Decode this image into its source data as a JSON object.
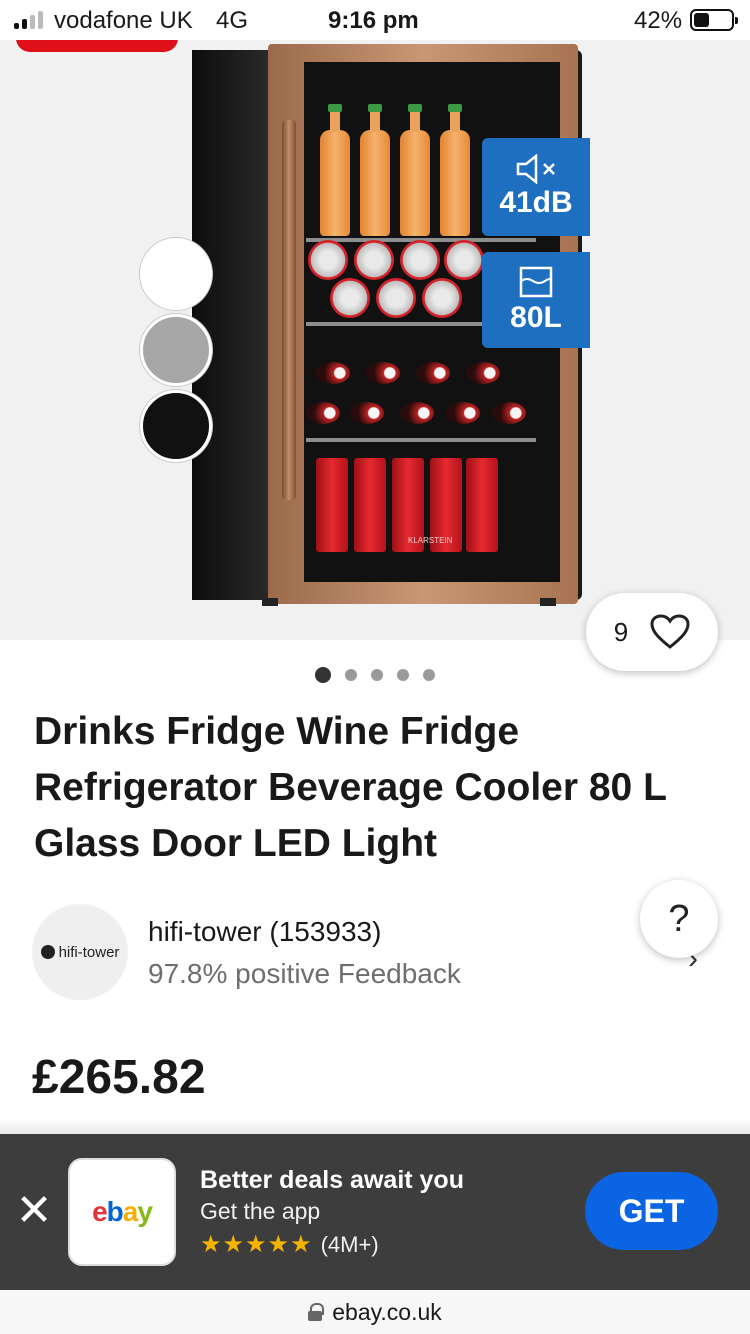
{
  "status_bar": {
    "carrier": "vodafone UK",
    "network": "4G",
    "time": "9:16 pm",
    "battery_percent": "42%",
    "battery_level": 0.42
  },
  "gallery": {
    "spec_badges": [
      {
        "value": "41dB",
        "icon": "speaker-mute-icon"
      },
      {
        "value": "80L",
        "icon": "capacity-icon"
      }
    ],
    "colour_swatches": [
      "#ffffff",
      "#a7a7a7",
      "#111111"
    ],
    "current_image": 1,
    "image_count": 5,
    "watch_count": "9",
    "product_brand_print": "KLARSTEIN"
  },
  "product": {
    "title": "Drinks Fridge Wine Fridge Refrigerator Beverage Cooler 80 L Glass Door LED Light",
    "price": "£265.82"
  },
  "seller": {
    "avatar_text": "hifi-tower",
    "name": "hifi-tower (153933)",
    "feedback": "97.8% positive Feedback"
  },
  "help": {
    "label": "?"
  },
  "app_banner": {
    "headline": "Better deals await you",
    "subline": "Get the app",
    "stars": "★★★★★",
    "rating_count": "(4M+)",
    "cta": "GET",
    "close": "✕",
    "logo": {
      "e": "e",
      "b": "b",
      "a": "a",
      "y": "y"
    }
  },
  "url_bar": {
    "domain": "ebay.co.uk"
  },
  "colors": {
    "accent_blue": "#0a64e4",
    "badge_blue": "#1f6fc1",
    "sale_red": "#e0101a",
    "banner_bg": "#3d3d3d"
  }
}
